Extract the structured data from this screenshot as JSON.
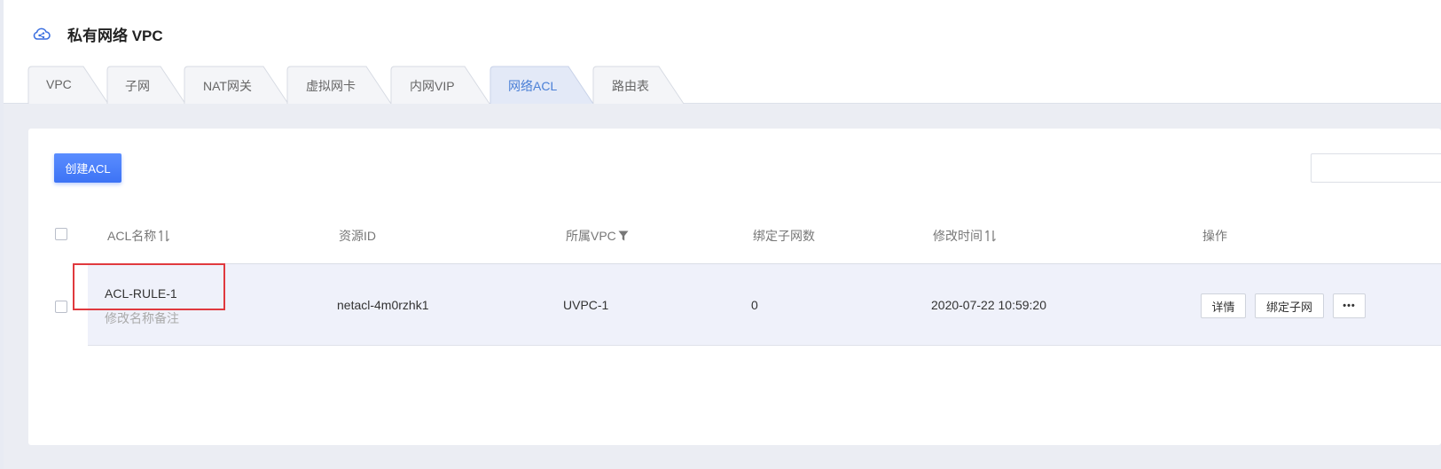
{
  "page": {
    "title": "私有网络 VPC"
  },
  "tabs": [
    {
      "label": "VPC"
    },
    {
      "label": "子网"
    },
    {
      "label": "NAT网关"
    },
    {
      "label": "虚拟网卡"
    },
    {
      "label": "内网VIP"
    },
    {
      "label": "网络ACL",
      "active": true
    },
    {
      "label": "路由表"
    }
  ],
  "toolbar": {
    "create_label": "创建ACL",
    "search_placeholder": ""
  },
  "table": {
    "columns": {
      "name": "ACL名称",
      "resource_id": "资源ID",
      "vpc": "所属VPC",
      "subnet_count": "绑定子网数",
      "modified": "修改时间",
      "actions": "操作"
    },
    "rows": [
      {
        "name": "ACL-RULE-1",
        "note": "修改名称备注",
        "resource_id": "netacl-4m0rzhk1",
        "vpc": "UVPC-1",
        "subnet_count": "0",
        "modified": "2020-07-22 10:59:20",
        "actions": {
          "detail": "详情",
          "bind": "绑定子网",
          "more": "•••"
        }
      }
    ]
  },
  "colors": {
    "accent": "#3d73f5",
    "active_tab_text": "#4a7fd6",
    "highlight": "#e0393e"
  },
  "icons": {
    "header": "cloud-share-icon",
    "sort": "sort-icon",
    "filter": "filter-icon"
  }
}
